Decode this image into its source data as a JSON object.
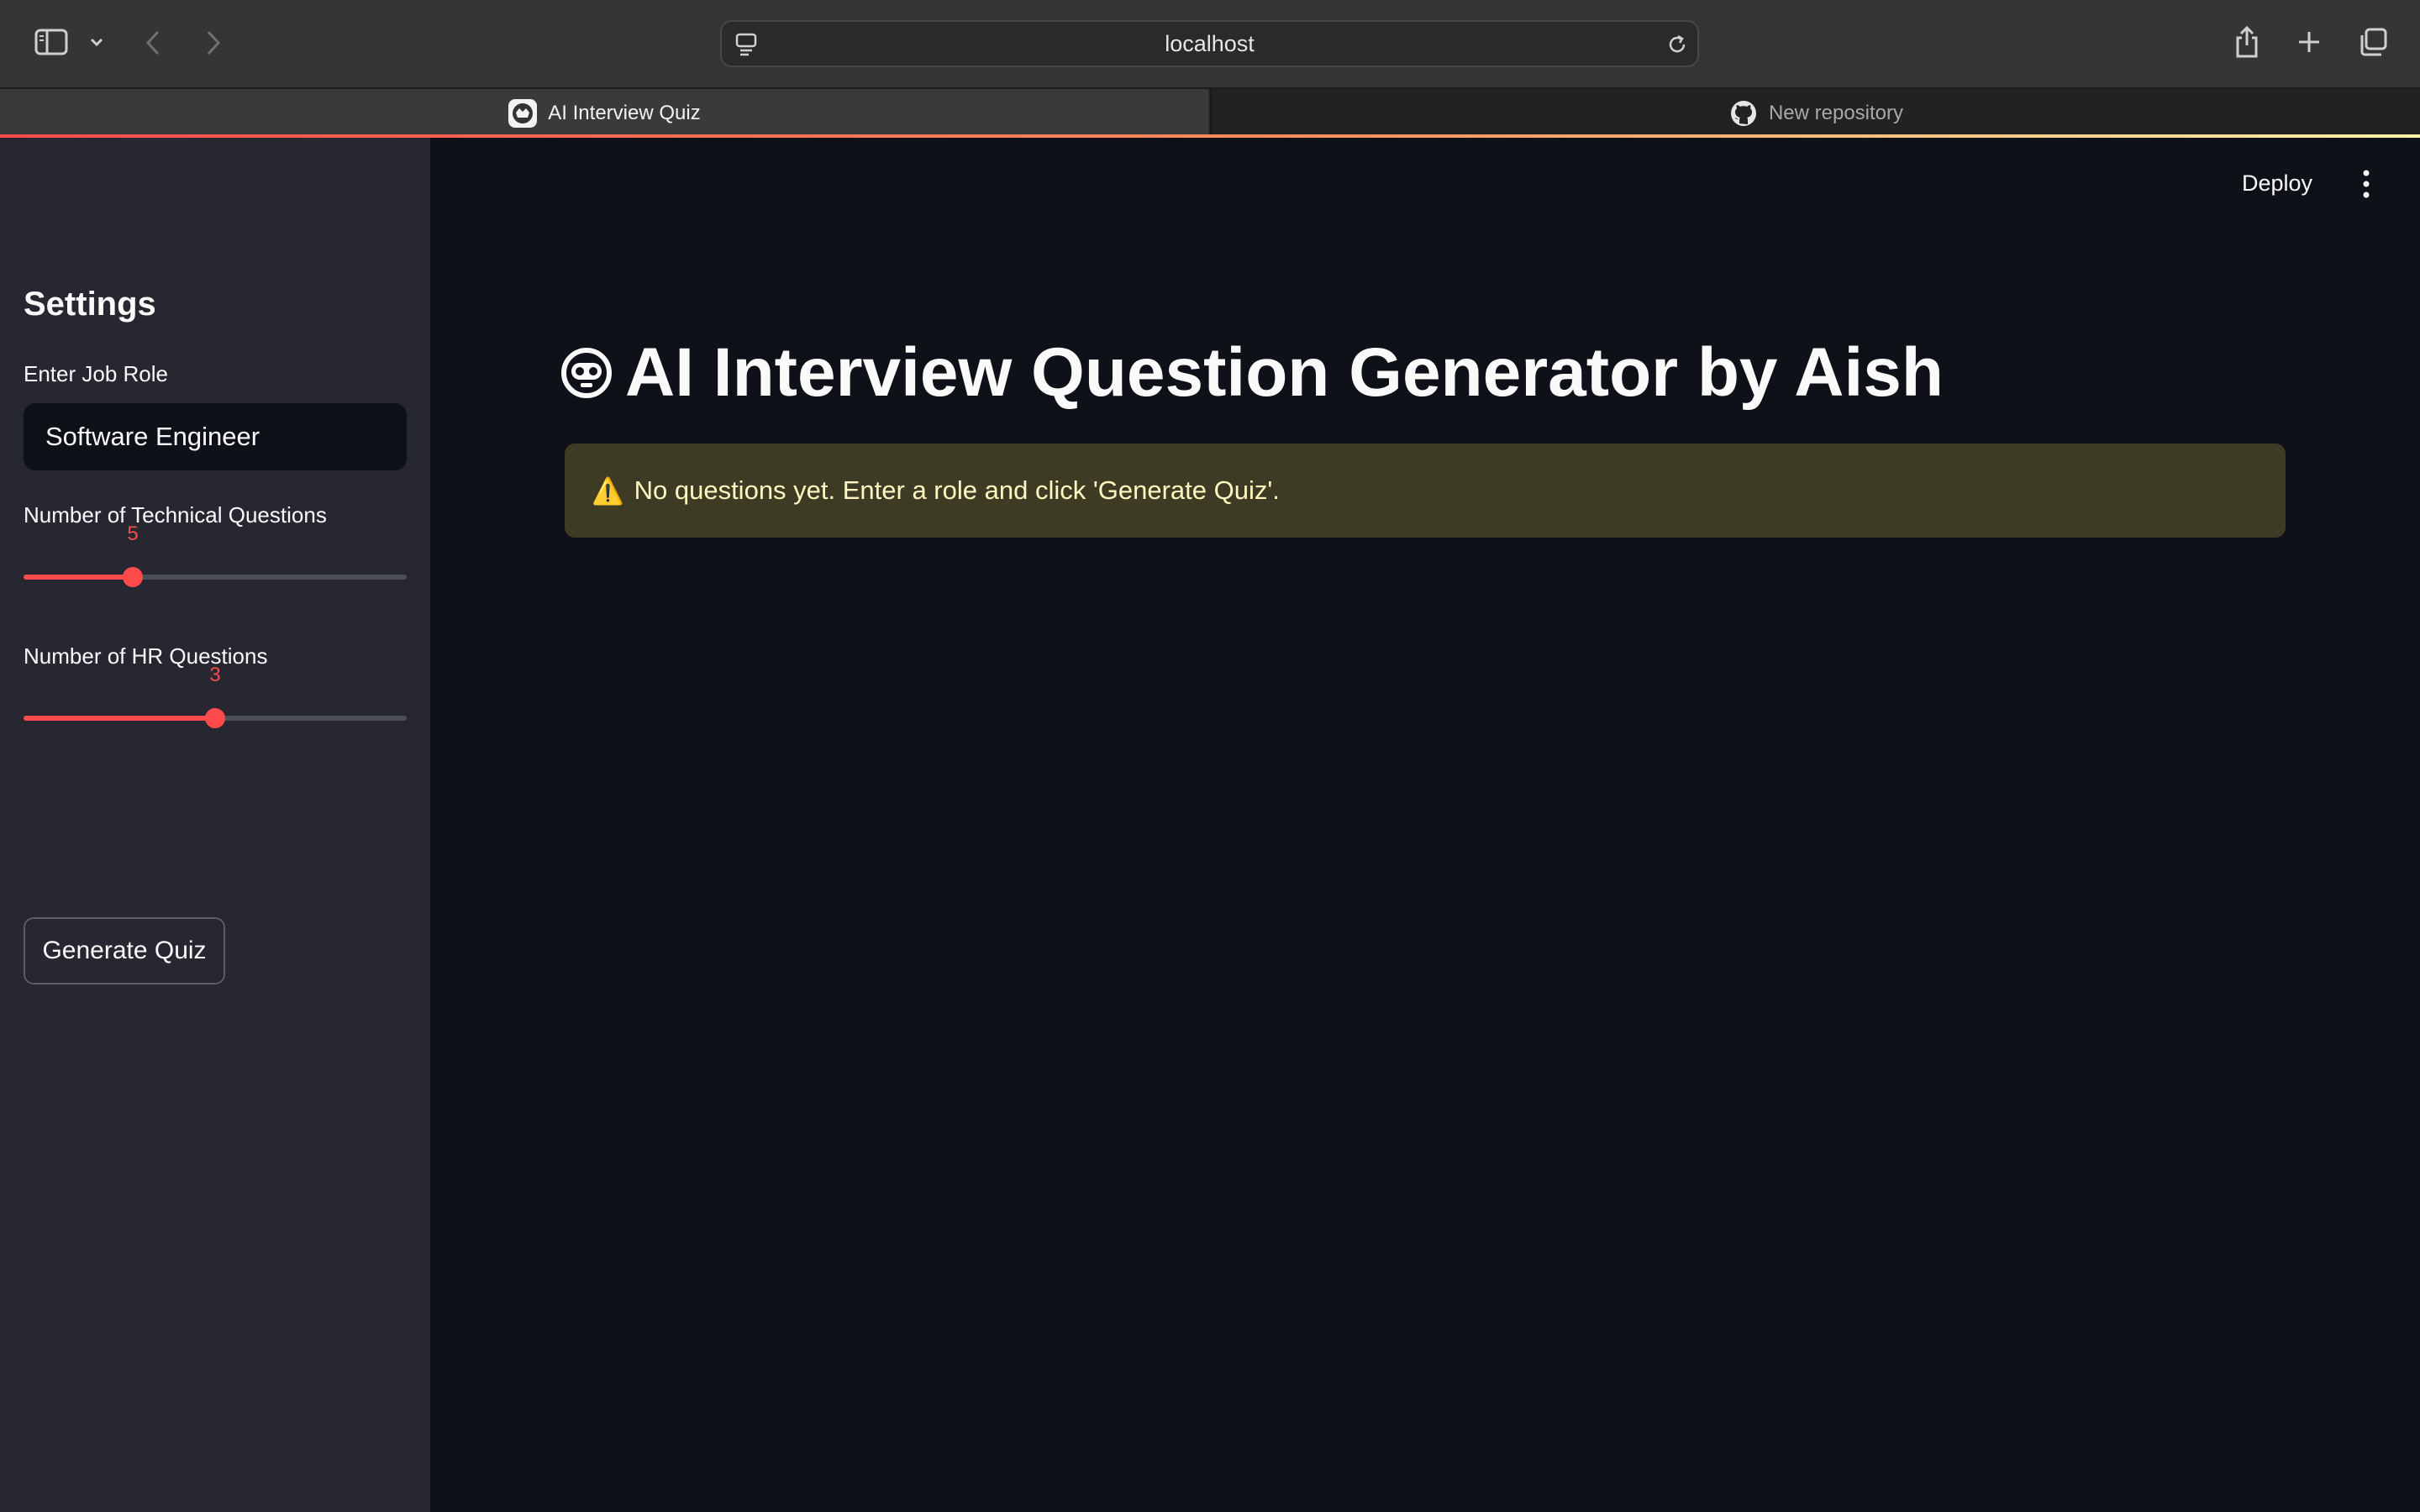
{
  "browser": {
    "address": "localhost",
    "tabs": [
      {
        "label": "AI Interview Quiz",
        "active": true
      },
      {
        "label": "New repository",
        "active": false
      }
    ]
  },
  "sidebar": {
    "title": "Settings",
    "job_role": {
      "label": "Enter Job Role",
      "value": "Software Engineer"
    },
    "technical_slider": {
      "label": "Number of Technical Questions",
      "value": "5",
      "fraction": 0.286
    },
    "hr_slider": {
      "label": "Number of HR Questions",
      "value": "3",
      "fraction": 0.5
    },
    "generate_button": "Generate Quiz"
  },
  "header": {
    "deploy_label": "Deploy"
  },
  "main": {
    "title": "AI Interview Question Generator by Aish",
    "warning_icon": "⚠️",
    "warning_text": "No questions yet. Enter a role and click 'Generate Quiz'."
  },
  "colors": {
    "accent": "#ff4b4b",
    "background": "#0e1117",
    "sidebar": "#262730",
    "warning_bg": "#3e3b24"
  }
}
